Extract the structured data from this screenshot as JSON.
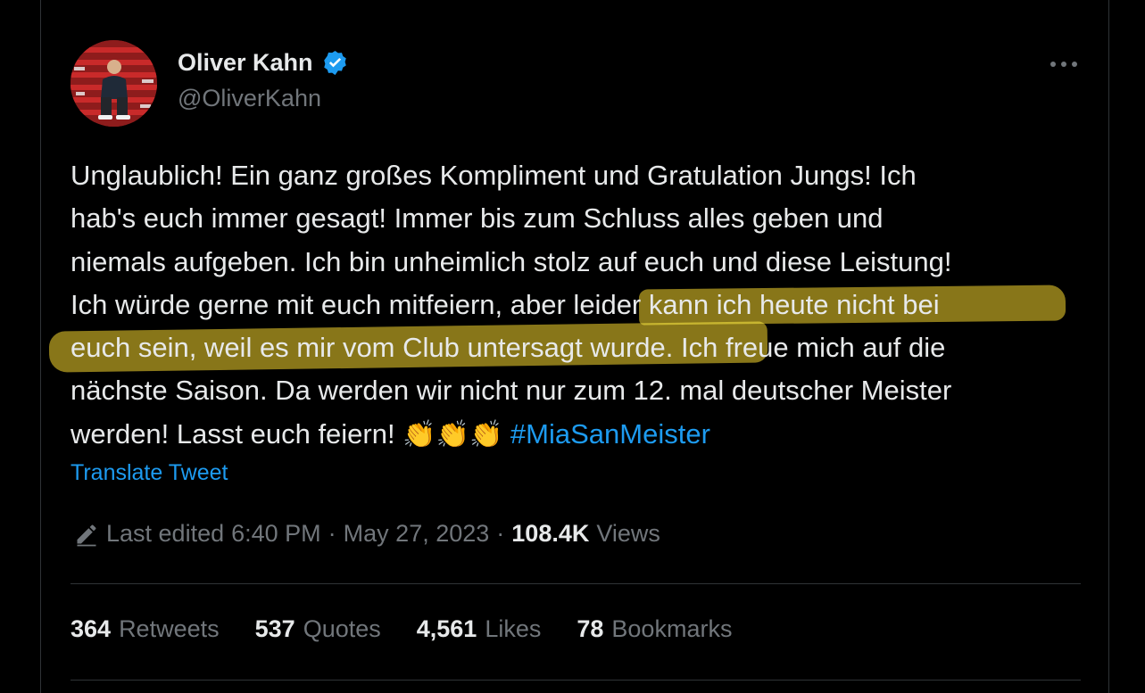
{
  "author": {
    "name": "Oliver Kahn",
    "handle": "@OliverKahn"
  },
  "tweet": {
    "text_lines": {
      "l1": "Unglaublich! Ein ganz großes Kompliment und Gratulation Jungs! Ich",
      "l2": "hab's euch immer gesagt! Immer bis zum Schluss alles geben und",
      "l3": "niemals aufgeben. Ich bin unheimlich stolz auf euch und diese Leistung!",
      "l4": "Ich würde gerne mit euch mitfeiern, aber leider kann ich heute nicht bei",
      "l5": "euch sein, weil es mir vom Club untersagt wurde. Ich freue mich auf die",
      "l6": "nächste Saison. Da werden wir nicht nur zum 12. mal deutscher Meister",
      "l7": "werden! Lasst euch feiern!"
    },
    "emojis": "👏👏👏",
    "hashtag": "#MiaSanMeister",
    "translate_label": "Translate Tweet"
  },
  "meta": {
    "edited_label": "Last edited",
    "time": "6:40 PM",
    "separator": "·",
    "date": "May 27, 2023",
    "views_count": "108.4K",
    "views_label": "Views"
  },
  "stats": {
    "retweets": {
      "count": "364",
      "label": "Retweets"
    },
    "quotes": {
      "count": "537",
      "label": "Quotes"
    },
    "likes": {
      "count": "4,561",
      "label": "Likes"
    },
    "bookmarks": {
      "count": "78",
      "label": "Bookmarks"
    }
  },
  "colors": {
    "background": "#000000",
    "text": "#e7e9ea",
    "secondary": "#71767b",
    "accent": "#1d9bf0",
    "highlighter": "#dcbe28"
  },
  "icons": [
    "verified-badge-icon",
    "more-options-icon",
    "edit-pencil-icon"
  ]
}
